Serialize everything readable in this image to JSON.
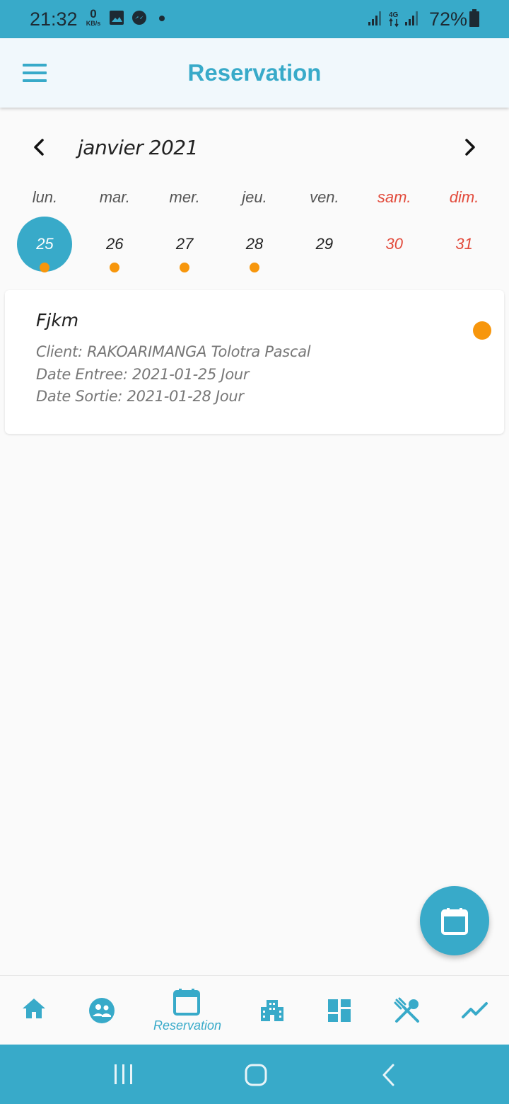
{
  "status_bar": {
    "time": "21:32",
    "net_speed_value": "0",
    "net_speed_unit": "KB/s",
    "battery": "72%",
    "network": "4G",
    "icons": [
      "image-icon",
      "messenger-icon",
      "dot-icon",
      "signal-icon",
      "4g-icon",
      "signal-icon",
      "battery-icon"
    ]
  },
  "appbar": {
    "title": "Reservation",
    "menu_icon": "hamburger-menu-icon"
  },
  "calendar": {
    "month_label": "janvier 2021",
    "prev_icon": "chevron-left-icon",
    "next_icon": "chevron-right-icon",
    "weekdays": [
      {
        "label": "lun.",
        "weekend": false
      },
      {
        "label": "mar.",
        "weekend": false
      },
      {
        "label": "mer.",
        "weekend": false
      },
      {
        "label": "jeu.",
        "weekend": false
      },
      {
        "label": "ven.",
        "weekend": false
      },
      {
        "label": "sam.",
        "weekend": true
      },
      {
        "label": "dim.",
        "weekend": true
      }
    ],
    "days": [
      {
        "day": "25",
        "selected": true,
        "has_event": true,
        "weekend": false
      },
      {
        "day": "26",
        "selected": false,
        "has_event": true,
        "weekend": false
      },
      {
        "day": "27",
        "selected": false,
        "has_event": true,
        "weekend": false
      },
      {
        "day": "28",
        "selected": false,
        "has_event": true,
        "weekend": false
      },
      {
        "day": "29",
        "selected": false,
        "has_event": false,
        "weekend": false
      },
      {
        "day": "30",
        "selected": false,
        "has_event": false,
        "weekend": true
      },
      {
        "day": "31",
        "selected": false,
        "has_event": false,
        "weekend": true
      }
    ]
  },
  "reservations": [
    {
      "name": "Fjkm",
      "client": "Client: RAKOARIMANGA Tolotra Pascal",
      "date_entree": "Date Entree: 2021-01-25 Jour",
      "date_sortie": "Date Sortie: 2021-01-28 Jour",
      "status_color": "#f7960c"
    }
  ],
  "fab": {
    "icon": "calendar-icon"
  },
  "bottom_nav": {
    "items": [
      {
        "icon": "home-icon",
        "label": ""
      },
      {
        "icon": "clients-icon",
        "label": ""
      },
      {
        "icon": "calendar-icon",
        "label": "Reservation",
        "active": true
      },
      {
        "icon": "building-icon",
        "label": ""
      },
      {
        "icon": "dashboard-icon",
        "label": ""
      },
      {
        "icon": "restaurant-icon",
        "label": ""
      },
      {
        "icon": "trending-icon",
        "label": ""
      }
    ]
  },
  "system_nav": {
    "icons": [
      "recents-icon",
      "home-button-icon",
      "back-icon"
    ]
  },
  "colors": {
    "primary": "#38aac9",
    "event_dot": "#f7960c",
    "weekend": "#e24a3b",
    "appbar_bg": "#f1f8fc"
  }
}
